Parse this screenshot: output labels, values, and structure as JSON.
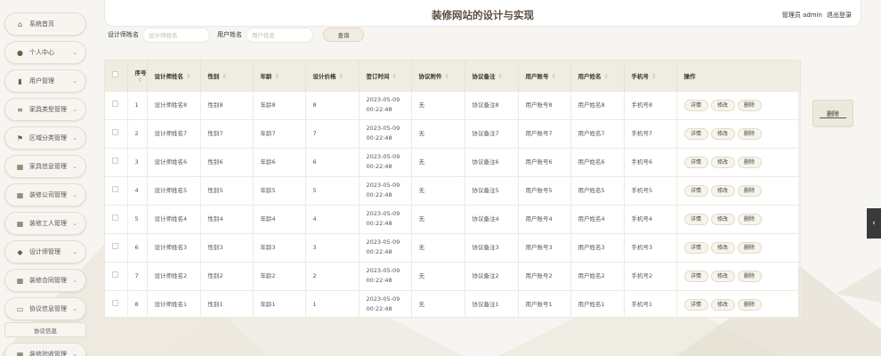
{
  "site_title": "装修网站的设计与实现",
  "header": {
    "user_label": "管理员 admin",
    "logout": "退出登录"
  },
  "sidebar": {
    "items": [
      {
        "label": "系统首页",
        "icon": "home-icon",
        "glyph": "⌂",
        "has_chevron": false
      },
      {
        "label": "个人中心",
        "icon": "user-icon",
        "glyph": "●",
        "has_chevron": true
      },
      {
        "label": "用户管理",
        "icon": "bar-chart-icon",
        "glyph": "▮",
        "has_chevron": true
      },
      {
        "label": "家具类型管理",
        "icon": "list-icon",
        "glyph": "≡",
        "has_chevron": true
      },
      {
        "label": "区域分类管理",
        "icon": "flag-icon",
        "glyph": "⚑",
        "has_chevron": true
      },
      {
        "label": "家具信息管理",
        "icon": "grid-icon",
        "glyph": "▦",
        "has_chevron": true
      },
      {
        "label": "装修公司管理",
        "icon": "grid-icon",
        "glyph": "▦",
        "has_chevron": true
      },
      {
        "label": "装修工人管理",
        "icon": "grid-icon",
        "glyph": "▦",
        "has_chevron": true
      },
      {
        "label": "设计师管理",
        "icon": "location-icon",
        "glyph": "◆",
        "has_chevron": true
      },
      {
        "label": "装修合同管理",
        "icon": "grid-icon",
        "glyph": "▦",
        "has_chevron": true
      },
      {
        "label": "协议信息管理",
        "icon": "monitor-icon",
        "glyph": "▭",
        "has_chevron": true
      },
      {
        "label": "装修验收管理",
        "icon": "grid-icon",
        "glyph": "▦",
        "has_chevron": true
      }
    ],
    "sub_item": "协议信息"
  },
  "search": {
    "designer_label": "设计师姓名",
    "designer_placeholder": "设计师姓名",
    "user_label": "用户姓名",
    "user_placeholder": "用户姓名",
    "query_button": "查询"
  },
  "table": {
    "columns": [
      "序号",
      "设计师姓名",
      "性别",
      "年龄",
      "设计价格",
      "签订时间",
      "协议附件",
      "协议备注",
      "用户账号",
      "用户姓名",
      "手机号",
      "操作"
    ],
    "rows": [
      {
        "no": "1",
        "name": "设计师姓名8",
        "gender": "性别8",
        "age": "年龄8",
        "price": "8",
        "date": "2023-05-09",
        "time": "00:22:48",
        "attach": "无",
        "note": "协议备注8",
        "account": "用户账号8",
        "uname": "用户姓名8",
        "phone": "手机号8"
      },
      {
        "no": "2",
        "name": "设计师姓名7",
        "gender": "性别7",
        "age": "年龄7",
        "price": "7",
        "date": "2023-05-09",
        "time": "00:22:48",
        "attach": "无",
        "note": "协议备注7",
        "account": "用户账号7",
        "uname": "用户姓名7",
        "phone": "手机号7"
      },
      {
        "no": "3",
        "name": "设计师姓名6",
        "gender": "性别6",
        "age": "年龄6",
        "price": "6",
        "date": "2023-05-09",
        "time": "00:22:48",
        "attach": "无",
        "note": "协议备注6",
        "account": "用户账号6",
        "uname": "用户姓名6",
        "phone": "手机号6"
      },
      {
        "no": "4",
        "name": "设计师姓名5",
        "gender": "性别5",
        "age": "年龄5",
        "price": "5",
        "date": "2023-05-09",
        "time": "00:22:48",
        "attach": "无",
        "note": "协议备注5",
        "account": "用户账号5",
        "uname": "用户姓名5",
        "phone": "手机号5"
      },
      {
        "no": "5",
        "name": "设计师姓名4",
        "gender": "性别4",
        "age": "年龄4",
        "price": "4",
        "date": "2023-05-09",
        "time": "00:22:48",
        "attach": "无",
        "note": "协议备注4",
        "account": "用户账号4",
        "uname": "用户姓名4",
        "phone": "手机号4"
      },
      {
        "no": "6",
        "name": "设计师姓名3",
        "gender": "性别3",
        "age": "年龄3",
        "price": "3",
        "date": "2023-05-09",
        "time": "00:22:48",
        "attach": "无",
        "note": "协议备注3",
        "account": "用户账号3",
        "uname": "用户姓名3",
        "phone": "手机号3"
      },
      {
        "no": "7",
        "name": "设计师姓名2",
        "gender": "性别2",
        "age": "年龄2",
        "price": "2",
        "date": "2023-05-09",
        "time": "00:22:48",
        "attach": "无",
        "note": "协议备注2",
        "account": "用户账号2",
        "uname": "用户姓名2",
        "phone": "手机号2"
      },
      {
        "no": "8",
        "name": "设计师姓名1",
        "gender": "性别1",
        "age": "年龄1",
        "price": "1",
        "date": "2023-05-09",
        "time": "00:22:48",
        "attach": "无",
        "note": "协议备注1",
        "account": "用户账号1",
        "uname": "用户姓名1",
        "phone": "手机号1"
      }
    ],
    "actions": {
      "detail": "详情",
      "edit": "修改",
      "delete": "删除"
    }
  },
  "delete_button": "删除",
  "side_tab_glyph": "‹",
  "colors": {
    "accent": "#efece1",
    "title": "#5b5041",
    "button_bg": "#f7f4ec"
  }
}
